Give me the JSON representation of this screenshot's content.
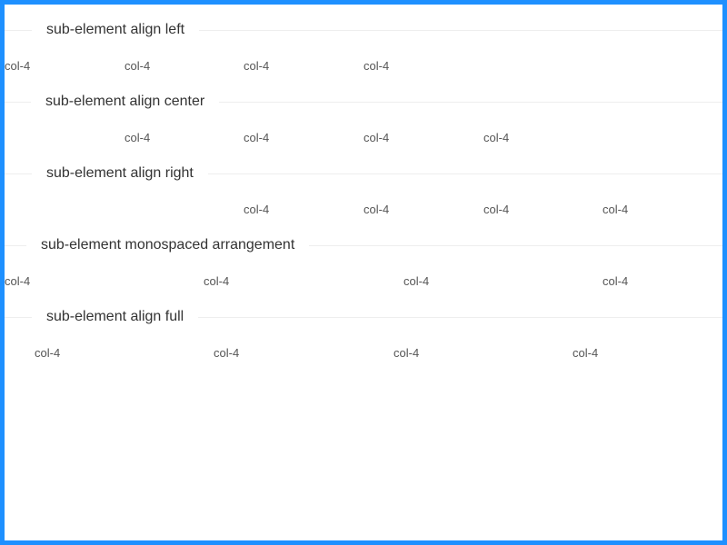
{
  "sections": [
    {
      "title": "sub-element align left",
      "cells": [
        "col-4",
        "col-4",
        "col-4",
        "col-4"
      ]
    },
    {
      "title": "sub-element align center",
      "cells": [
        "col-4",
        "col-4",
        "col-4",
        "col-4"
      ]
    },
    {
      "title": "sub-element align right",
      "cells": [
        "col-4",
        "col-4",
        "col-4",
        "col-4"
      ]
    },
    {
      "title": "sub-element monospaced arrangement",
      "cells": [
        "col-4",
        "col-4",
        "col-4",
        "col-4"
      ]
    },
    {
      "title": "sub-element align full",
      "cells": [
        "col-4",
        "col-4",
        "col-4",
        "col-4"
      ]
    }
  ]
}
